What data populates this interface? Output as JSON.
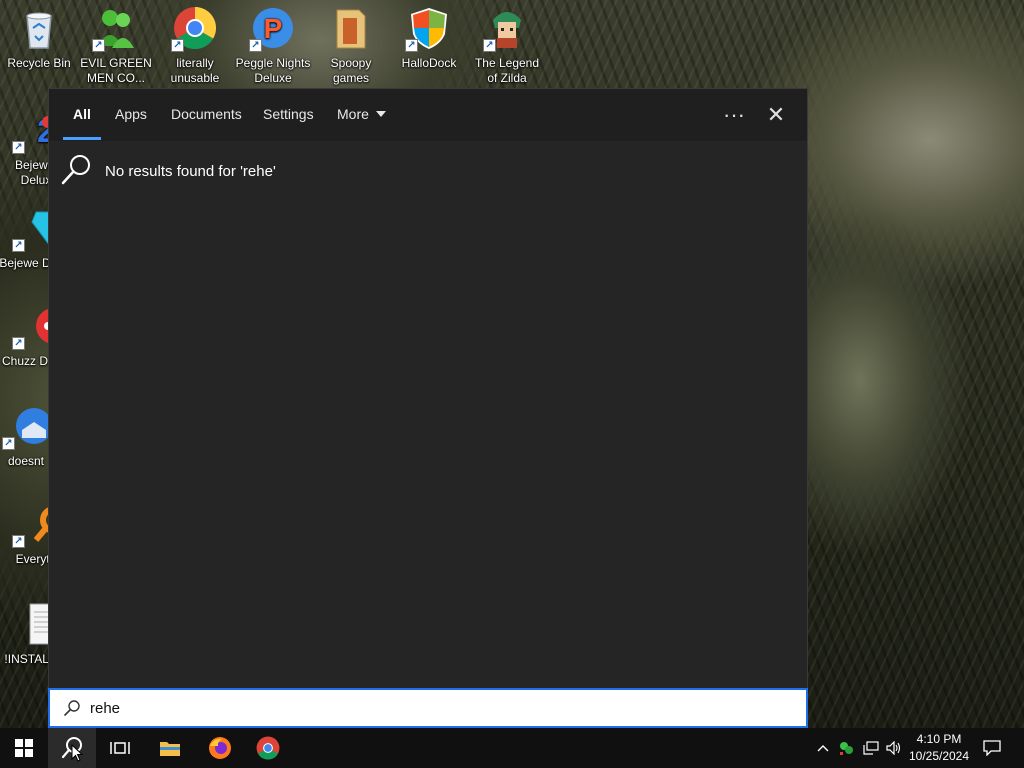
{
  "desktop": {
    "icons": [
      {
        "label": "Recycle Bin",
        "icon": "recycle-bin-icon"
      },
      {
        "label": "EVIL GREEN MEN CO...",
        "icon": "green-men-icon"
      },
      {
        "label": "literally unusable",
        "icon": "chrome-icon"
      },
      {
        "label": "Peggle Nights Deluxe",
        "icon": "peggle-icon"
      },
      {
        "label": "Spoopy games",
        "icon": "folder-icon"
      },
      {
        "label": "HalloDock",
        "icon": "windows-shield-icon"
      },
      {
        "label": "The Legend of Zilda",
        "icon": "zilda-icon"
      },
      {
        "label": "Bejewel Delux",
        "icon": "bejeweled-2-icon"
      },
      {
        "label": "Bejewe Delux",
        "icon": "bejeweled-gem-icon"
      },
      {
        "label": "Chuzz Delux",
        "icon": "chuzzle-icon"
      },
      {
        "label": "doesnt",
        "icon": "thunderbird-icon"
      },
      {
        "label": "Everyth",
        "icon": "everything-search-icon"
      },
      {
        "label": "!INSTALL",
        "icon": "text-file-icon"
      }
    ]
  },
  "search": {
    "tabs": [
      "All",
      "Apps",
      "Documents",
      "Settings",
      "More"
    ],
    "active_tab": "All",
    "more_options": "···",
    "close": "✕",
    "message": "No results found for 'rehe'",
    "query": "rehe"
  },
  "taskbar": {
    "apps": [
      "start-icon",
      "search-icon",
      "task-view-icon",
      "file-explorer-icon",
      "firefox-icon",
      "chrome-icon"
    ],
    "tray": [
      "chevron-up-icon",
      "network-green-icon",
      "network-icon",
      "volume-icon"
    ],
    "time": "4:10 PM",
    "date": "10/25/2024"
  },
  "colors": {
    "accent": "#1f6feb",
    "panel": "#252525",
    "taskbar": "#101010"
  }
}
